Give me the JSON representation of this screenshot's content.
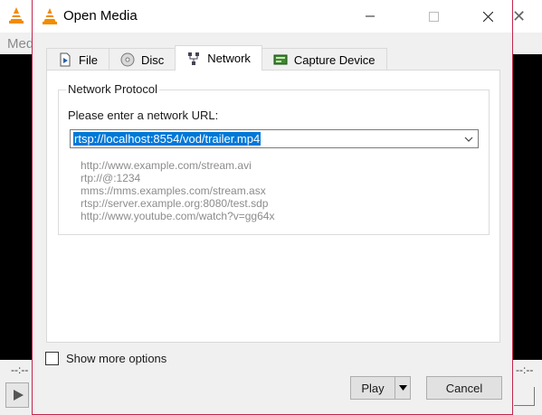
{
  "background_app": {
    "title_fragment": "Med",
    "time_left": "--:--",
    "time_right": "--:--"
  },
  "dialog": {
    "title": "Open Media",
    "icon": "vlc-cone-icon"
  },
  "tabs": [
    {
      "label": "File",
      "icon": "file-icon",
      "active": false
    },
    {
      "label": "Disc",
      "icon": "disc-icon",
      "active": false
    },
    {
      "label": "Network",
      "icon": "network-icon",
      "active": true
    },
    {
      "label": "Capture Device",
      "icon": "capture-device-icon",
      "active": false
    }
  ],
  "network": {
    "group_title": "Network Protocol",
    "url_label": "Please enter a network URL:",
    "url_value": "rtsp://localhost:8554/vod/trailer.mp4",
    "examples": [
      "http://www.example.com/stream.avi",
      "rtp://@:1234",
      "mms://mms.examples.com/stream.asx",
      "rtsp://server.example.org:8080/test.sdp",
      "http://www.youtube.com/watch?v=gg64x"
    ]
  },
  "options": {
    "show_more_label": "Show more options",
    "show_more_checked": false
  },
  "buttons": {
    "play_label": "Play",
    "cancel_label": "Cancel"
  },
  "colors": {
    "selection": "#0078d7",
    "dialog_border": "#c0284d",
    "vlc_orange": "#f28c00"
  }
}
